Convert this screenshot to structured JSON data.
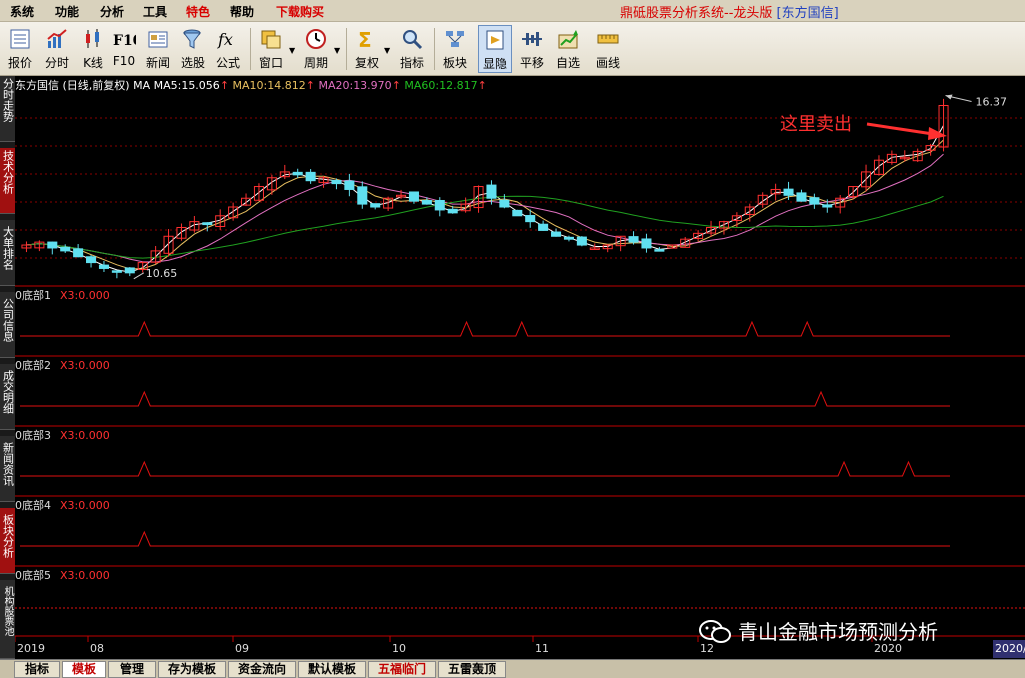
{
  "menu": [
    "系统",
    "功能",
    "分析",
    "工具",
    "特色",
    "帮助",
    "下载购买"
  ],
  "app_title": "鼎砥股票分析系统--龙头版",
  "app_stock": "[东方国信]",
  "toolbar": [
    {
      "label": "报价",
      "icon": "quote-list-icon"
    },
    {
      "label": "分时",
      "icon": "intraday-chart-icon"
    },
    {
      "label": "K线",
      "icon": "candlestick-icon"
    },
    {
      "label": "F10",
      "icon": "f10-text-icon"
    },
    {
      "label": "新闻",
      "icon": "news-icon"
    },
    {
      "label": "选股",
      "icon": "funnel-icon"
    },
    {
      "label": "公式",
      "icon": "formula-fx-icon"
    },
    {
      "label": "窗口",
      "icon": "window-icon"
    },
    {
      "label": "周期",
      "icon": "clock-icon"
    },
    {
      "label": "复权",
      "icon": "sigma-icon"
    },
    {
      "label": "指标",
      "icon": "magnifier-icon"
    },
    {
      "label": "板块",
      "icon": "sector-icon"
    },
    {
      "label": "显隐",
      "icon": "show-hide-icon"
    },
    {
      "label": "平移",
      "icon": "pan-icon"
    },
    {
      "label": "自选",
      "icon": "watchlist-icon"
    },
    {
      "label": "画线",
      "icon": "draw-line-icon"
    }
  ],
  "left_tabs": [
    "分时走势",
    "技术分析",
    "大单排名",
    "公司信息",
    "成交明细",
    "新闻资讯",
    "板块分析",
    "机构股票池"
  ],
  "legend": {
    "prefix": "东方国信 (日线,前复权) MA",
    "ma5": "MA5:15.056",
    "ma10": "MA10:14.812",
    "ma20": "MA20:13.970",
    "ma60": "MA60:12.817",
    "up_arrow": "↑"
  },
  "colors": {
    "ma5": "#ffffff",
    "ma10": "#e8c060",
    "ma20": "#e070c0",
    "ma60": "#20a020",
    "up_candle": "#ff3030",
    "down_candle": "#60e0f0",
    "grid": "#8a0000",
    "indicator_line": "#e01010"
  },
  "annotation": {
    "text": "这里卖出",
    "high_label": "16.37",
    "low_label": "10.65"
  },
  "panels": [
    {
      "name": "0底部1",
      "value": "X3:0.000"
    },
    {
      "name": "0底部2",
      "value": "X3:0.000"
    },
    {
      "name": "0底部3",
      "value": "X3:0.000"
    },
    {
      "name": "0底部4",
      "value": "X3:0.000"
    },
    {
      "name": "0底部5",
      "value": "X3:0.000"
    }
  ],
  "x_axis": [
    "2019",
    "08",
    "09",
    "10",
    "11",
    "12",
    "2020"
  ],
  "x_axis_end": "2020/",
  "bottom_tabs": [
    "指标",
    "模板",
    "管理",
    "存为模板",
    "资金流向",
    "默认模板",
    "五福临门",
    "五雷轰顶"
  ],
  "watermark": "青山金融市场预测分析",
  "chart_data": {
    "type": "candlestick",
    "series_name": "东方国信",
    "period": "日线,前复权",
    "x": [
      "2019",
      "08",
      "09",
      "10",
      "11",
      "12",
      "2020"
    ],
    "price_range": [
      10.2,
      16.9
    ],
    "high": 16.37,
    "low": 10.65,
    "close_path": [
      11.6,
      11.7,
      11.5,
      11.4,
      11.2,
      11.0,
      10.8,
      10.7,
      10.65,
      11.0,
      11.4,
      11.9,
      12.2,
      12.4,
      12.3,
      12.6,
      12.9,
      13.2,
      13.6,
      13.9,
      14.1,
      14.0,
      13.8,
      13.9,
      13.7,
      13.5,
      13.0,
      12.9,
      13.2,
      13.3,
      13.1,
      13.0,
      12.8,
      12.7,
      13.0,
      13.6,
      13.2,
      12.9,
      12.6,
      12.4,
      12.1,
      11.9,
      11.8,
      11.6,
      11.5,
      11.6,
      11.9,
      11.7,
      11.5,
      11.4,
      11.6,
      11.8,
      12.0,
      12.2,
      12.4,
      12.6,
      12.9,
      13.3,
      13.5,
      13.3,
      13.1,
      13.0,
      12.9,
      13.2,
      13.6,
      14.1,
      14.5,
      14.7,
      14.6,
      14.8,
      15.0,
      16.37
    ],
    "ma5_last": 15.056,
    "ma10_last": 14.812,
    "ma20_last": 13.97,
    "ma60_last": 12.817,
    "indicator_peaks": [
      [
        0.135,
        0.485,
        0.545,
        0.795,
        0.855
      ],
      [
        0.135,
        0.87
      ],
      [
        0.135,
        0.895,
        0.965
      ],
      [
        0.135
      ],
      []
    ]
  }
}
